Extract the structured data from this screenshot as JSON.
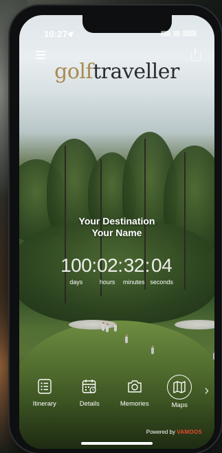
{
  "status_bar": {
    "time": "10:27"
  },
  "header": {
    "logo_part1": "golf",
    "logo_part2": "traveller"
  },
  "hero": {
    "destination": "Your Destination",
    "name": "Your Name"
  },
  "countdown": {
    "days": "100",
    "hours": "02",
    "minutes": "32",
    "seconds": "04",
    "labels": {
      "days": "days",
      "hours": "hours",
      "minutes": "minutes",
      "seconds": "seconds"
    }
  },
  "tabs": [
    {
      "label": "Itinerary",
      "icon": "list-icon"
    },
    {
      "label": "Details",
      "icon": "calendar-icon"
    },
    {
      "label": "Memories",
      "icon": "camera-icon"
    },
    {
      "label": "Maps",
      "icon": "map-icon"
    }
  ],
  "footer": {
    "powered_by": "Powered by",
    "brand": "VAMOOS"
  },
  "colors": {
    "logo_gold": "#a98a4e",
    "logo_dark": "#2b2b2e",
    "brand_accent": "#e84a2c"
  }
}
